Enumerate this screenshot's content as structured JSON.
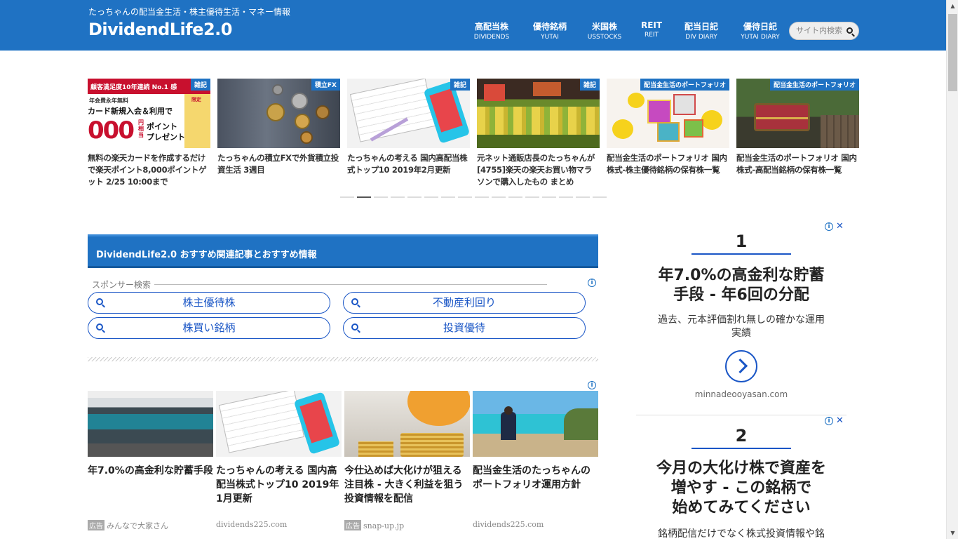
{
  "header": {
    "tagline": "たっちゃんの配当金生活・株主優待生活・マネー情報",
    "logo": "DividendLife2.0",
    "nav": [
      {
        "ja": "高配当株",
        "en": "DIVIDENDS"
      },
      {
        "ja": "優待銘柄",
        "en": "YUTAI"
      },
      {
        "ja": "米国株",
        "en": "USSTOCKS"
      },
      {
        "ja": "REIT",
        "en": "REIT"
      },
      {
        "ja": "配当日記",
        "en": "DIV DIARY"
      },
      {
        "ja": "優待日記",
        "en": "YUTAI DIARY"
      }
    ],
    "search_placeholder": "サイト内検索"
  },
  "carousel": {
    "cards": [
      {
        "category": "雑記",
        "title": "無料の楽天カードを作成するだけで楽天ポイント8,000ポイントゲット 2/25 10:00まで",
        "thumb_text": [
          "顧客満足度10年連続 No.1 感",
          "年会費永年無料",
          "カード新規入会＆利用で",
          "000",
          "円相当",
          "ポイント",
          "プレゼント",
          "限定"
        ]
      },
      {
        "category": "積立FX",
        "title": "たっちゃんの積立FXで外貨積立投資生活 3週目"
      },
      {
        "category": "雑記",
        "title": "たっちゃんの考える 国内高配当株式トップ10 2019年2月更新"
      },
      {
        "category": "雑記",
        "title": "元ネット通販店長のたっちゃんが[4755]楽天の楽天お買い物マラソンで購入したもの まとめ"
      },
      {
        "category": "配当金生活のポートフォリオ",
        "title": "配当金生活のポートフォリオ 国内株式-株主優待銘柄の保有株一覧"
      },
      {
        "category": "配当金生活のポートフォリオ",
        "title": "配当金生活のポートフォリオ 国内株式-高配当銘柄の保有株一覧"
      }
    ],
    "dots": 16,
    "active_dot": 1
  },
  "recommend": {
    "title": "DividendLife2.0 おすすめ関連記事とおすすめ情報"
  },
  "sponsor": {
    "label": "スポンサー検索",
    "links": [
      "株主優待株",
      "不動産利回り",
      "株買い銘柄",
      "投資優待"
    ]
  },
  "ads": [
    {
      "title": "年7.0%の高金利な貯蓄手段",
      "badge": "広告",
      "source": "みんなで大家さん"
    },
    {
      "title": "たっちゃんの考える 国内高配当株式トップ10 2019年1月更新",
      "badge": "",
      "source": "dividends225.com"
    },
    {
      "title": "今仕込めば大化けが狙える注目株 - 大きく利益を狙う投資情報を配信",
      "badge": "広告",
      "source": "snap-up.jp"
    },
    {
      "title": "配当金生活のたっちゃんのポートフォリオ運用方針",
      "badge": "",
      "source": "dividends225.com"
    }
  ],
  "side_ads": [
    {
      "num": "1",
      "headline_1": "年7.0%の高金利な貯蓄",
      "headline_2": "手段 - 年6回の分配",
      "body_1": "過去、元本評価割れ無しの確かな運用",
      "body_2": "実績",
      "domain": "minnadeooyasan.com"
    },
    {
      "num": "2",
      "headline_1": "今月の大化け株で資産を",
      "headline_2": "増やす - この銘柄で",
      "headline_3": "始めてみてください",
      "body_1": "銘柄配信だけでなく株式投資情報や銘"
    }
  ]
}
